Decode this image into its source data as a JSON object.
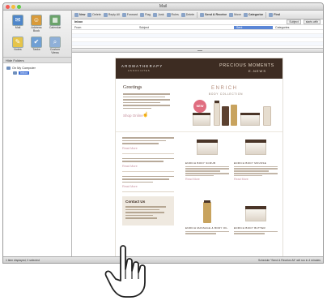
{
  "window": {
    "title": "Mail"
  },
  "sidebar": {
    "nav": [
      {
        "label": "Mail",
        "icon": "mail-icon",
        "glyph": "✉",
        "color": "#4f86c9"
      },
      {
        "label": "Address Book",
        "icon": "address-book-icon",
        "glyph": "☺",
        "color": "#d89a3a"
      },
      {
        "label": "Calendar",
        "icon": "calendar-icon",
        "glyph": "▦",
        "color": "#6aa36a"
      },
      {
        "label": "Notes",
        "icon": "notes-icon",
        "glyph": "✎",
        "color": "#e6c44a"
      },
      {
        "label": "Tasks",
        "icon": "tasks-icon",
        "glyph": "✔",
        "color": "#6f9fd4"
      },
      {
        "label": "Custom Views",
        "icon": "custom-views-icon",
        "glyph": "⌕",
        "color": "#8fb0d8"
      }
    ],
    "folders_header": "Hide Folders",
    "tree": [
      {
        "label": "On My Computer",
        "selected": false,
        "sub": false
      },
      {
        "label": "Inbox",
        "selected": true,
        "sub": true
      }
    ]
  },
  "toolbar": {
    "buttons": [
      {
        "label": "New",
        "icon": "new-icon",
        "strong": true
      },
      {
        "label": "Delete",
        "icon": "delete-icon",
        "strong": false
      },
      {
        "label": "Reply All",
        "icon": "reply-all-icon",
        "strong": false
      },
      {
        "label": "Forward",
        "icon": "forward-icon",
        "strong": false
      },
      {
        "label": "Flag",
        "icon": "flag-icon",
        "strong": false
      },
      {
        "label": "Junk",
        "icon": "junk-icon",
        "strong": false
      },
      {
        "label": "Rules",
        "icon": "rules-icon",
        "strong": false
      },
      {
        "label": "Delete",
        "icon": "delete2-icon",
        "strong": false
      },
      {
        "label": "Send & Receive",
        "icon": "send-receive-icon",
        "strong": true
      },
      {
        "label": "Move",
        "icon": "move-icon",
        "strong": false
      },
      {
        "label": "Categorize",
        "icon": "categorize-icon",
        "strong": true
      },
      {
        "label": "Find",
        "icon": "find-icon",
        "strong": true
      }
    ]
  },
  "list": {
    "inbox_label": "Inbox",
    "filter_pills": [
      "Subject",
      "starts with"
    ],
    "columns": {
      "from": "From",
      "subject": "Subject",
      "sent": "Sent",
      "categories": "Categories"
    }
  },
  "newsletter": {
    "brand": "AROMATHERAPY",
    "brand_sub": "ASSOCIATES",
    "header_title": "PRECIOUS MOMENTS",
    "header_sub": "E-NEWS",
    "greeting": "Greetings",
    "shop_link": "Shop Online",
    "collection_title": "ENRICH",
    "collection_sub": "BODY COLLECTION",
    "badge": "NEW",
    "read_more": "Read More",
    "contact_title": "Contact Us",
    "products": [
      "ENRICH BODY SCRUB",
      "ENRICH BODY MOUSSE",
      "ENRICH MASSAGE & BODY OIL",
      "ENRICH BODY BUTTER"
    ]
  },
  "status": {
    "left": "1 item displayed, 0 selected",
    "right": "Schedule \"Send & Receive All\" will run in 4 minutes"
  }
}
